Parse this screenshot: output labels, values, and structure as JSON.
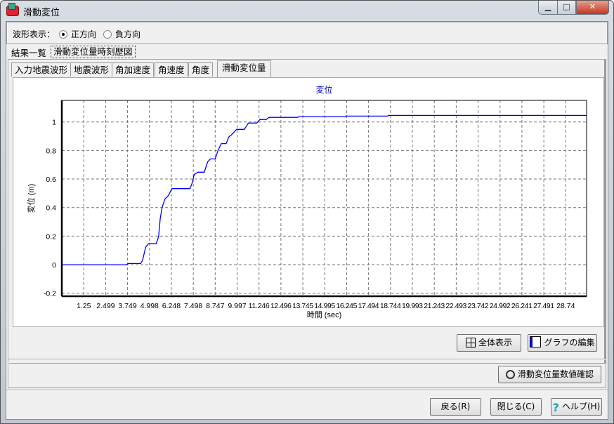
{
  "window": {
    "title": "滑動変位",
    "minimize": "▁",
    "maximize": "□",
    "close": "✕"
  },
  "waveform": {
    "label": "波形表示：",
    "options": [
      {
        "label": "正方向",
        "selected": true
      },
      {
        "label": "負方向",
        "selected": false
      }
    ]
  },
  "outer_tabs": [
    {
      "label": "結果一覧"
    },
    {
      "label": "滑動変位量時刻歴図",
      "selected": true
    }
  ],
  "inner_tabs": [
    {
      "label": "入力地震波形"
    },
    {
      "label": "地震波形"
    },
    {
      "label": "角加速度"
    },
    {
      "label": "角速度"
    },
    {
      "label": "角度"
    },
    {
      "label": "滑動変位量",
      "selected": true
    }
  ],
  "buttons": {
    "fit_all": "全体表示",
    "edit_graph": "グラフの編集",
    "check_values": "滑動変位量数値確認",
    "back": "戻る(R)",
    "close": "閉じる(C)",
    "help": "ヘルプ(H)"
  },
  "colors": {
    "series": "#0000ff",
    "title": "#0000c0"
  },
  "chart_data": {
    "type": "line",
    "title": "変位",
    "xlabel": "時間 (sec)",
    "ylabel": "変位 (m)",
    "xlim": [
      0,
      29.93
    ],
    "ylim": [
      -0.221,
      1.151
    ],
    "grid": true,
    "xticks": [
      1.25,
      2.499,
      3.749,
      4.998,
      6.248,
      7.498,
      8.747,
      9.997,
      11.246,
      12.496,
      13.745,
      14.995,
      16.245,
      17.494,
      18.744,
      19.993,
      21.243,
      22.493,
      23.742,
      24.992,
      26.241,
      27.491,
      28.74
    ],
    "xtick_labels": [
      "1.25",
      "2.499",
      "3.749",
      "4.998",
      "6.248",
      "7.498",
      "8.747",
      "9.997",
      "11.246",
      "12.496",
      "13.745",
      "14.995",
      "16.245",
      "17.494",
      "18.744",
      "19.993",
      "21.243",
      "22.493",
      "23.742",
      "24.992",
      "26.241",
      "27.491",
      "28.74"
    ],
    "yticks": [
      -0.2,
      0,
      0.2,
      0.4,
      0.6,
      0.8,
      1
    ],
    "ytick_labels": [
      "-0.2",
      "0",
      "0.2",
      "0.4",
      "0.6",
      "0.8",
      "1"
    ],
    "series": [
      {
        "name": "変位",
        "x": [
          0,
          3.71,
          3.78,
          4.5,
          4.61,
          4.78,
          4.94,
          5.38,
          5.52,
          5.61,
          5.72,
          5.88,
          6.08,
          6.28,
          7.31,
          7.44,
          7.55,
          7.75,
          8.12,
          8.32,
          8.48,
          8.75,
          8.92,
          9.1,
          9.37,
          9.52,
          9.68,
          9.97,
          10.41,
          10.64,
          11.12,
          11.3,
          11.66,
          11.82,
          13.46,
          13.5,
          16.15,
          16.2,
          18.59,
          18.62,
          29.93
        ],
        "y": [
          0,
          0,
          0.008,
          0.008,
          0.033,
          0.123,
          0.147,
          0.147,
          0.197,
          0.32,
          0.402,
          0.46,
          0.484,
          0.533,
          0.533,
          0.574,
          0.631,
          0.648,
          0.648,
          0.721,
          0.741,
          0.741,
          0.804,
          0.848,
          0.848,
          0.894,
          0.91,
          0.948,
          0.948,
          0.992,
          0.992,
          1.017,
          1.017,
          1.032,
          1.032,
          1.036,
          1.036,
          1.041,
          1.041,
          1.046,
          1.046
        ]
      }
    ]
  }
}
